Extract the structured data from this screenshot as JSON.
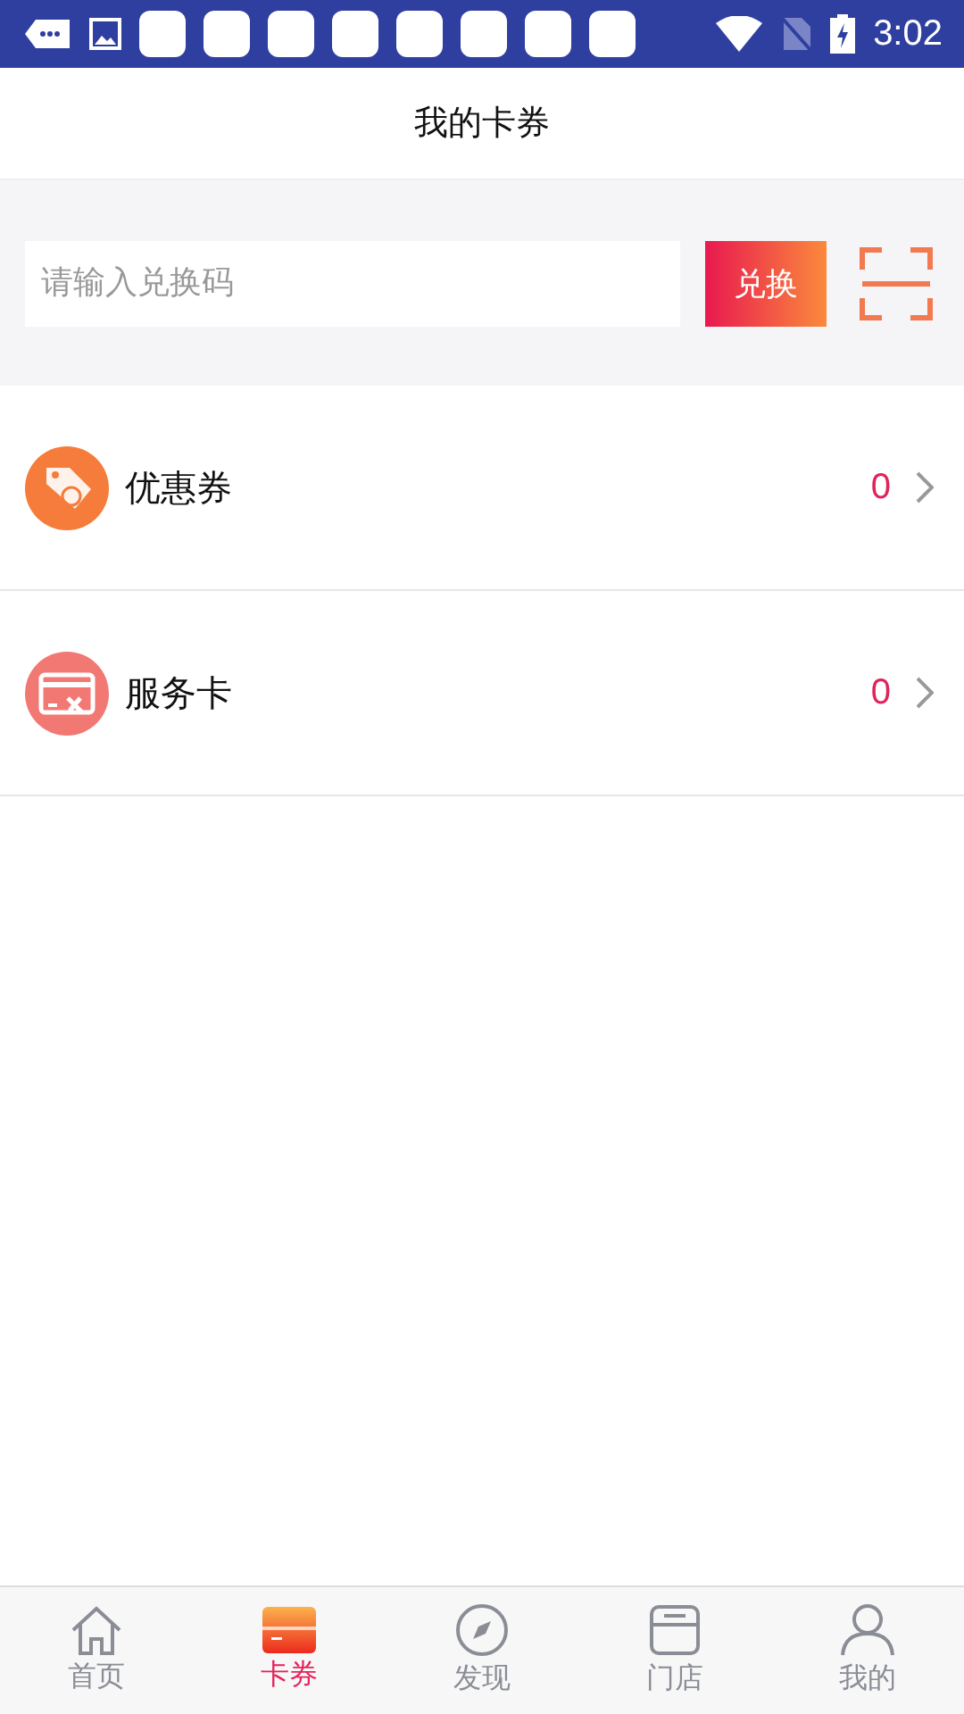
{
  "status_bar": {
    "time": "3:02",
    "notifications": [
      {
        "kind": "app"
      },
      {
        "kind": "app"
      },
      {
        "kind": "app"
      },
      {
        "kind": "app"
      },
      {
        "kind": "app"
      },
      {
        "kind": "app"
      },
      {
        "kind": "app"
      },
      {
        "kind": "app"
      }
    ]
  },
  "header": {
    "title": "我的卡券"
  },
  "redeem": {
    "placeholder": "请输入兑换码",
    "button": "兑换"
  },
  "items": [
    {
      "kind": "coupon",
      "label": "优惠券",
      "count": "0"
    },
    {
      "kind": "service",
      "label": "服务卡",
      "count": "0"
    }
  ],
  "tabs": [
    {
      "kind": "home",
      "label": "首页",
      "selected": false
    },
    {
      "kind": "card",
      "label": "卡券",
      "selected": true
    },
    {
      "kind": "discover",
      "label": "发现",
      "selected": false
    },
    {
      "kind": "store",
      "label": "门店",
      "selected": false
    },
    {
      "kind": "profile",
      "label": "我的",
      "selected": false
    }
  ]
}
